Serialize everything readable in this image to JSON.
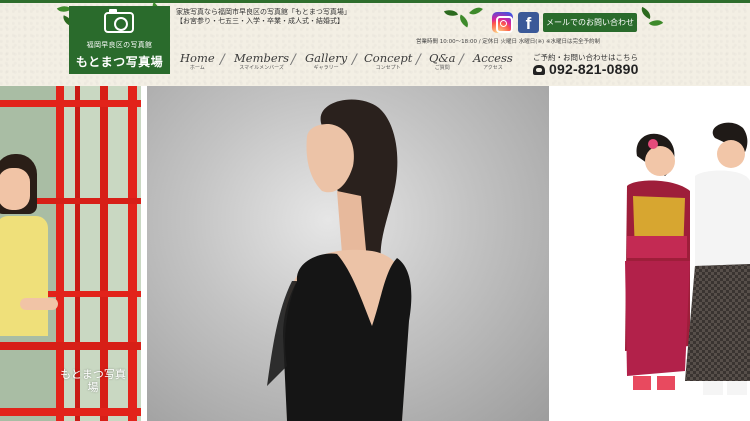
{
  "header": {
    "tagline_1": "家族写真なら福岡市早良区の写真館「もとまつ写真場」",
    "tagline_2": "【お宮参り・七五三・入学・卒業・成人式・結婚式】",
    "logo": {
      "sub": "福岡早良区の写真館",
      "main": "もとまつ写真場"
    },
    "mail_button": "メールでのお問い合わせ",
    "hours": "営業時間  10:00〜18:00  /  定休日  火曜日  水曜日(※)  ※水曜日は完全予約制",
    "contact_label": "ご予約・お問い合わせはこちら",
    "tel": "092-821-0890",
    "icons": {
      "instagram": "instagram-icon",
      "facebook": "facebook-icon",
      "phone": "phone-icon"
    }
  },
  "nav": [
    {
      "en": "Home",
      "ja": "ホーム"
    },
    {
      "en": "Members",
      "ja": "スマイルメンバーズ"
    },
    {
      "en": "Gallery",
      "ja": "ギャラリー"
    },
    {
      "en": "Concept",
      "ja": "コンセプト"
    },
    {
      "en": "Q&a",
      "ja": "ご質問"
    },
    {
      "en": "Access",
      "ja": "アクセス"
    }
  ],
  "hero": {
    "left_logo": "もとまつ写真場",
    "slides": [
      "child-on-playground-photo",
      "woman-in-leotard-portrait",
      "kimono-children-photo"
    ]
  },
  "colors": {
    "brand_green": "#2a6b2c",
    "header_bg": "#f3efe4",
    "facebook": "#3b5998"
  }
}
